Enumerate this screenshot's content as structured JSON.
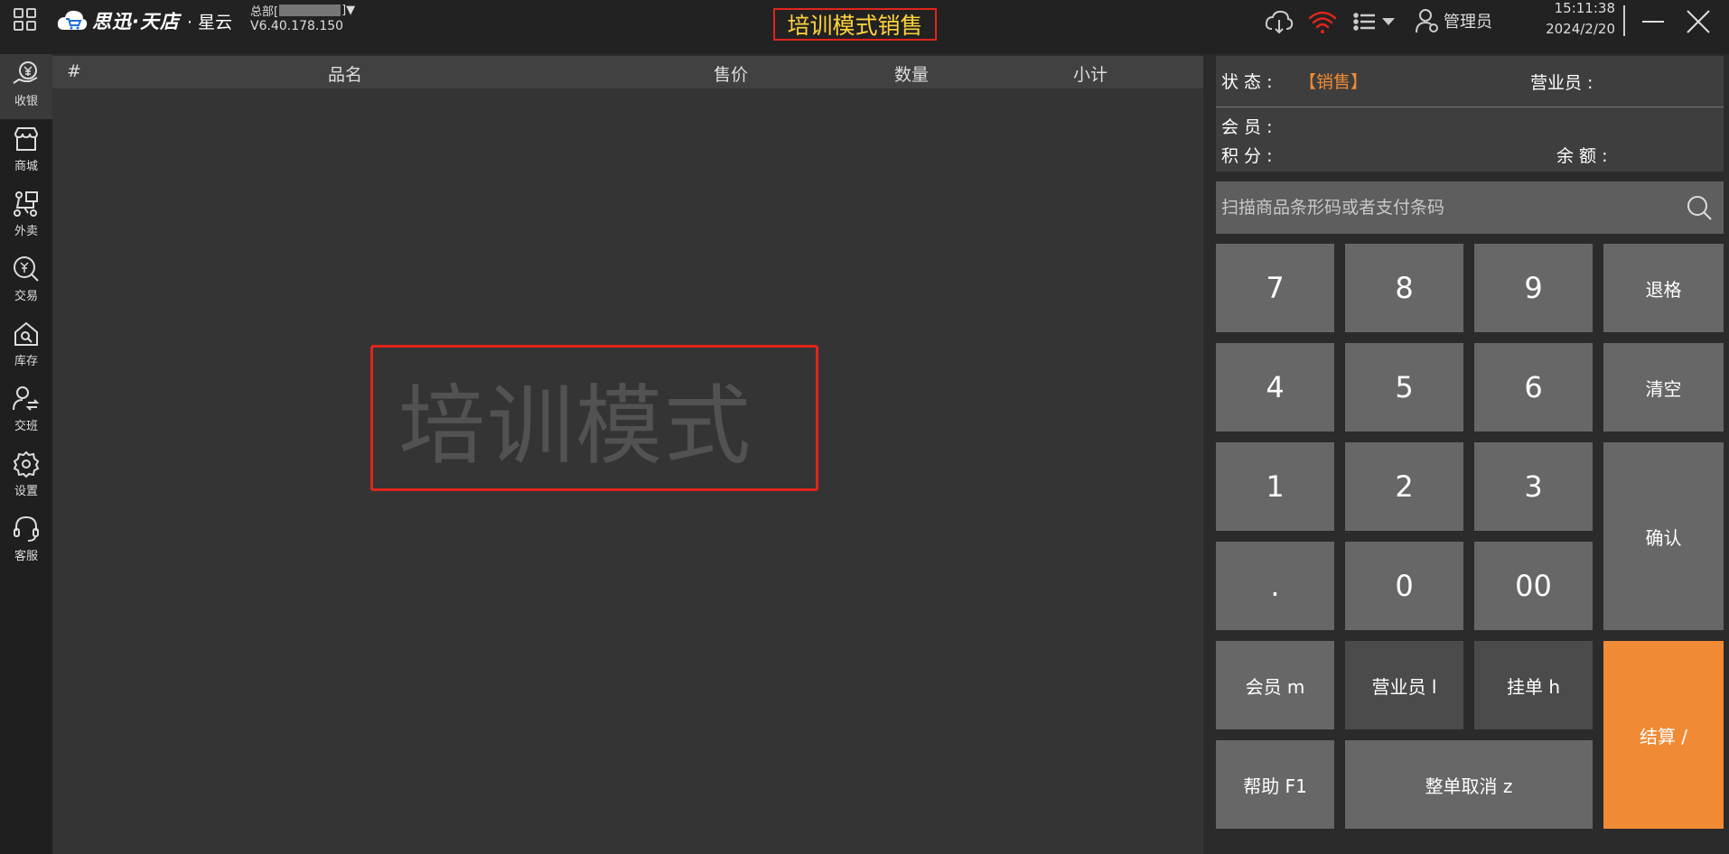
{
  "header": {
    "logo_text": "思迅·天店",
    "logo_sub": "· 星云",
    "branch_prefix": "总部[",
    "branch_suffix": "]▼",
    "version": "V6.40.178.150",
    "mode_title": "培训模式销售",
    "user_label": "管理员",
    "time": "15:11:38",
    "date": "2024/2/20"
  },
  "sidebar": {
    "items": [
      {
        "label": "收银",
        "icon": "cashier-icon"
      },
      {
        "label": "商城",
        "icon": "store-icon"
      },
      {
        "label": "外卖",
        "icon": "delivery-icon"
      },
      {
        "label": "交易",
        "icon": "transaction-icon"
      },
      {
        "label": "库存",
        "icon": "inventory-icon"
      },
      {
        "label": "交班",
        "icon": "shift-icon"
      },
      {
        "label": "设置",
        "icon": "settings-icon"
      },
      {
        "label": "客服",
        "icon": "support-icon"
      }
    ]
  },
  "table": {
    "columns": [
      "#",
      "品名",
      "售价",
      "数量",
      "小计"
    ],
    "rows": []
  },
  "watermark": "培训模式",
  "info": {
    "status_label": "状 态 :",
    "status_value": "【销售】",
    "salesperson_label": "营业员 :",
    "member_label": "会 员 :",
    "points_label": "积 分 :",
    "balance_label": "余 额 :"
  },
  "scan": {
    "placeholder": "扫描商品条形码或者支付条码"
  },
  "keypad": {
    "k7": "7",
    "k8": "8",
    "k9": "9",
    "backspace": "退格",
    "k4": "4",
    "k5": "5",
    "k6": "6",
    "clear": "清空",
    "k1": "1",
    "k2": "2",
    "k3": "3",
    "confirm": "确认",
    "dot": ".",
    "k0": "0",
    "k00": "00",
    "member": "会员 m",
    "salesperson": "营业员 l",
    "hold": "挂单 h",
    "checkout": "结算 /",
    "help": "帮助 F1",
    "cancel_order": "整单取消 z"
  },
  "colors": {
    "accent_orange": "#f08a34",
    "mode_title": "#ffd43b",
    "highlight_red": "#e1251b",
    "wifi_red": "#e1251b"
  }
}
